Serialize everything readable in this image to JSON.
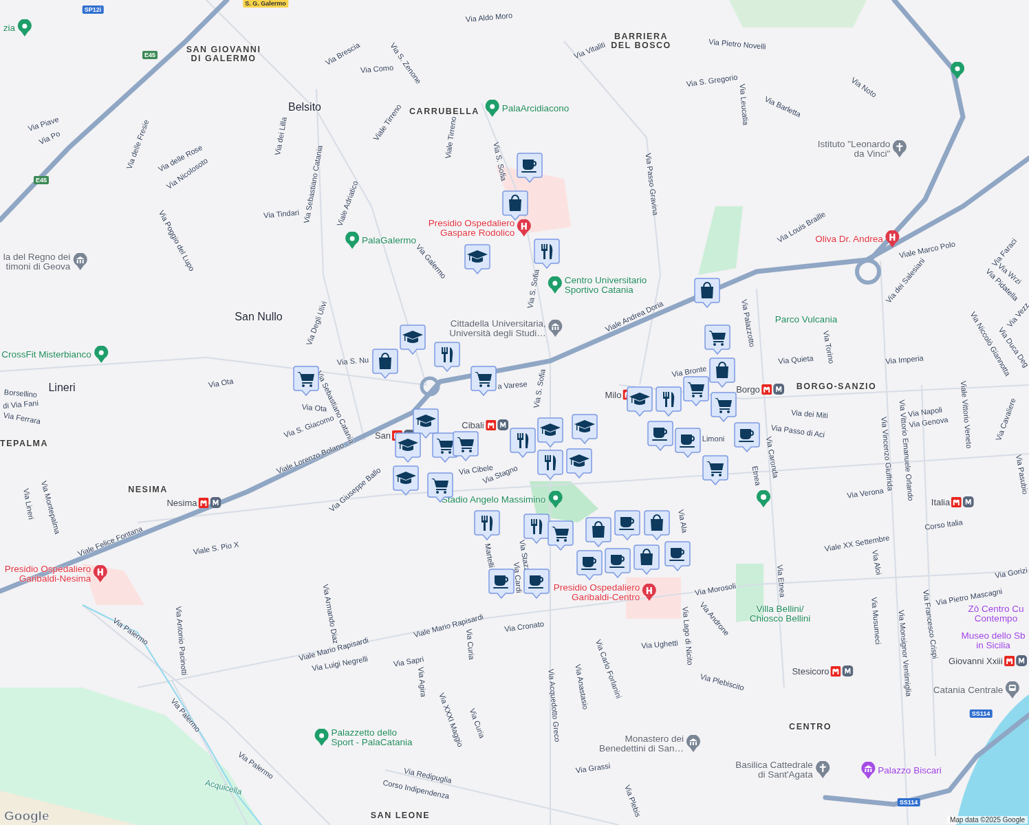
{
  "map": {
    "streets": [
      {
        "text": "Via Aldo Moro"
      },
      {
        "text": "Via Brescia"
      },
      {
        "text": "Via Como"
      },
      {
        "text": "Via S. Zenone"
      },
      {
        "text": "Via Vitaliti"
      },
      {
        "text": "Via Pietro Novelli"
      },
      {
        "text": "Via S. Gregorio"
      },
      {
        "text": "Via Leucatia"
      },
      {
        "text": "Via Barletta"
      },
      {
        "text": "Via Noto"
      },
      {
        "text": "Via Piave"
      },
      {
        "text": "Via Po"
      },
      {
        "text": "Via delle Fresie"
      },
      {
        "text": "Via delle Rose"
      },
      {
        "text": "Via Nicolosoto"
      },
      {
        "text": "Via dei Lilla"
      },
      {
        "text": "Via Sebastiano Catania"
      },
      {
        "text": "Viale Tirreno"
      },
      {
        "text": "Viale Tirreno"
      },
      {
        "text": "Viale Adriatico"
      },
      {
        "text": "Via Tindari"
      },
      {
        "text": "Via Poggio del Lupo"
      },
      {
        "text": "Via S. Sofia"
      },
      {
        "text": "Via Galermo"
      },
      {
        "text": "Via Passo Gravina"
      },
      {
        "text": "Via S. Sofia"
      },
      {
        "text": "Via Louis Braille"
      },
      {
        "text": "Viale Andrea Doria"
      },
      {
        "text": "Viale Marco Polo"
      },
      {
        "text": "Via Faraci"
      },
      {
        "text": "Via Wrzi"
      },
      {
        "text": "Via Pidatella"
      },
      {
        "text": "Via dei Salesiani"
      },
      {
        "text": "Via Palazzotto"
      },
      {
        "text": "Via Torino"
      },
      {
        "text": "Via Quieta"
      },
      {
        "text": "Via Imperia"
      },
      {
        "text": "Via Niccolò Giannotta"
      },
      {
        "text": "Via Duca Deg"
      },
      {
        "text": "Via Vezz"
      },
      {
        "text": "Via Bronte"
      },
      {
        "text": "Via Degli Ulivi"
      },
      {
        "text": "Via S. Nu"
      },
      {
        "text": "Via Ota"
      },
      {
        "text": "Via Ota"
      },
      {
        "text": "Via S. Giacomo"
      },
      {
        "text": "Via Sebastiano Catania"
      },
      {
        "text": "Borsellino"
      },
      {
        "text": "di Via Fani"
      },
      {
        "text": "Via Ferrara"
      },
      {
        "text": "Via S. Sofia"
      },
      {
        "text": "a Varese"
      },
      {
        "text": "Via dei Miti"
      },
      {
        "text": "Via Passo di Aci"
      },
      {
        "text": "Via Napoli"
      },
      {
        "text": "Via Genova"
      },
      {
        "text": "Via Vittorio Emanuele Orlando"
      },
      {
        "text": "Via Vincenzo Giuffrida"
      },
      {
        "text": "Viale Vittorio Veneto"
      },
      {
        "text": "Via Cavaliere"
      },
      {
        "text": "Via Caronda"
      },
      {
        "text": "Etnea"
      },
      {
        "text": "Viale Lorenzo Bolano"
      },
      {
        "text": "Via Cibele"
      },
      {
        "text": "Via Stagno"
      },
      {
        "text": "Via Giuseppe Ballo"
      },
      {
        "text": "Via Verona"
      },
      {
        "text": "Corso Italia"
      },
      {
        "text": "Viale XX Settembre"
      },
      {
        "text": "Via Pasubio"
      },
      {
        "text": "Via Aloi"
      },
      {
        "text": "Via Gorizi"
      },
      {
        "text": "Via Pietro Mascagni"
      },
      {
        "text": "Via Musumeci"
      },
      {
        "text": "Via Monsignor Ventimiglia"
      },
      {
        "text": "Via Francesco Crispi"
      },
      {
        "text": "Via Etnea"
      },
      {
        "text": "Via Morosoli"
      },
      {
        "text": "Via Androne"
      },
      {
        "text": "Via Lago di Nicito"
      },
      {
        "text": "Via Ughetti"
      },
      {
        "text": "Via Plebiscito"
      },
      {
        "text": "Via Carlo Forlanini"
      },
      {
        "text": "Via Anastasio"
      },
      {
        "text": "Via Acquedotto Greco"
      },
      {
        "text": "Via Grassi"
      },
      {
        "text": "Via Plebis"
      },
      {
        "text": "Via Cronato"
      },
      {
        "text": "Viale Mario Rapisardi"
      },
      {
        "text": "Viale Mario Rapisardi"
      },
      {
        "text": "Via Luigi Negrelli"
      },
      {
        "text": "Via Sapri"
      },
      {
        "text": "Via Curia"
      },
      {
        "text": "Via Curia"
      },
      {
        "text": "Via Agira"
      },
      {
        "text": "Via XXXI Maggio"
      },
      {
        "text": "Via Redipuglia"
      },
      {
        "text": "Corso Indipendenza"
      },
      {
        "text": "Via Armando Diaz"
      },
      {
        "text": "Via Antonio Pacinotti"
      },
      {
        "text": "Via Palermo"
      },
      {
        "text": "Via Palermo"
      },
      {
        "text": "Via Palermo"
      },
      {
        "text": "Viale Felice Fontana"
      },
      {
        "text": "Viale S. Pio X"
      },
      {
        "text": "Via Lineri"
      },
      {
        "text": "Via Montepalma"
      },
      {
        "text": "Martelli"
      },
      {
        "text": "Via Stazz"
      },
      {
        "text": "Via Cardi"
      },
      {
        "text": "Via Ala"
      },
      {
        "text": "Limoni"
      }
    ],
    "districts": [
      {
        "text": "SAN GIOVANNI"
      },
      {
        "text": "DI GALERMO"
      },
      {
        "text": "BARRIERA"
      },
      {
        "text": "DEL BOSCO"
      },
      {
        "text": "CARRUBELLA"
      },
      {
        "text": "NESIMA"
      },
      {
        "text": "TEPALMA"
      },
      {
        "text": "BORGO-SANZIO"
      },
      {
        "text": "CENTRO"
      },
      {
        "text": "SAN LEONE"
      }
    ],
    "towns": [
      {
        "text": "Belsito"
      },
      {
        "text": "San Nullo"
      },
      {
        "text": "Lineri"
      }
    ],
    "pois": [
      {
        "kind": "park",
        "lines": [
          "zia"
        ]
      },
      {
        "kind": "park",
        "lines": [
          "PalaArcidiacono"
        ]
      },
      {
        "kind": "park",
        "lines": [
          "PalaGalermo"
        ]
      },
      {
        "kind": "park",
        "lines": [
          "Centro Universitario",
          "Sportivo Catania"
        ]
      },
      {
        "kind": "park",
        "lines": [
          "CrossFit Misterbianco"
        ]
      },
      {
        "kind": "park",
        "lines": [
          "Palazzetto dello",
          "Sport - PalaCatania"
        ]
      },
      {
        "kind": "stadium",
        "lines": [
          "Stadio Angelo Massimino"
        ]
      },
      {
        "kind": "garden",
        "lines": [
          "Parco Vulcania"
        ]
      },
      {
        "kind": "garden",
        "lines": [
          "Villa Bellini/",
          "Chiosco Bellini"
        ]
      },
      {
        "kind": "hospital",
        "lines": [
          "Presidio Ospedaliero",
          "Gaspare Rodolico"
        ]
      },
      {
        "kind": "clinic",
        "lines": [
          "Oliva Dr. Andrea"
        ]
      },
      {
        "kind": "hospital",
        "lines": [
          "Presidio Ospedaliero",
          "Garibaldi-Nesima"
        ]
      },
      {
        "kind": "hospital",
        "lines": [
          "Presidio Ospedaliero",
          "Garibaldi-Centro"
        ]
      },
      {
        "kind": "church",
        "lines": [
          "Istituto \"Leonardo",
          "da Vinci\""
        ]
      },
      {
        "kind": "school",
        "lines": [
          "Cittadella Universitaria,",
          "Università degli Studi…"
        ]
      },
      {
        "kind": "hall",
        "lines": [
          "la del Regno dei",
          "timoni di Geova"
        ]
      },
      {
        "kind": "hall",
        "lines": [
          "Monastero dei",
          "Benedettini di San…"
        ]
      },
      {
        "kind": "church",
        "lines": [
          "Basilica Cattedrale",
          "di Sant'Agata"
        ]
      },
      {
        "kind": "train",
        "lines": [
          "Catania Centrale"
        ]
      },
      {
        "kind": "museum",
        "lines": [
          "Palazzo Biscari"
        ]
      },
      {
        "kind": "museum_text",
        "lines": [
          "Zō Centro Cu",
          "Contempo"
        ]
      },
      {
        "kind": "museum_text",
        "lines": [
          "Museo dello Sb",
          "in Sicilia"
        ]
      }
    ],
    "metro_stations": [
      {
        "name": "Cibali",
        "underground": true
      },
      {
        "name": "Milo",
        "underground": false
      },
      {
        "name": "Borgo",
        "underground": true
      },
      {
        "name": "Nesima",
        "underground": true
      },
      {
        "name": "Italia",
        "underground": true
      },
      {
        "name": "Stesicoro",
        "underground": true
      },
      {
        "name": "Giovanni Xxiii",
        "underground": true
      },
      {
        "name": "San",
        "underground": true
      }
    ],
    "shields": [
      {
        "kind": "provincial",
        "text": "SP12i"
      },
      {
        "kind": "european",
        "text": "E45"
      },
      {
        "kind": "european",
        "text": "E45"
      },
      {
        "kind": "state",
        "text": "SS114"
      },
      {
        "kind": "state",
        "text": "SS114"
      },
      {
        "kind": "locality",
        "text": "S. G. Galermo"
      }
    ],
    "water_labels": [
      {
        "text": "Acquicella"
      }
    ],
    "markers": [
      {
        "kind": "cafe"
      },
      {
        "kind": "shop"
      },
      {
        "kind": "restaurant"
      },
      {
        "kind": "school"
      },
      {
        "kind": "restaurant"
      },
      {
        "kind": "school"
      },
      {
        "kind": "shop"
      },
      {
        "kind": "grocery"
      },
      {
        "kind": "grocery"
      },
      {
        "kind": "school"
      },
      {
        "kind": "school"
      },
      {
        "kind": "grocery"
      },
      {
        "kind": "grocery"
      },
      {
        "kind": "grocery"
      },
      {
        "kind": "restaurant"
      },
      {
        "kind": "school"
      },
      {
        "kind": "restaurant"
      },
      {
        "kind": "school"
      },
      {
        "kind": "school"
      },
      {
        "kind": "school"
      },
      {
        "kind": "restaurant"
      },
      {
        "kind": "restaurant"
      },
      {
        "kind": "grocery"
      },
      {
        "kind": "cafe"
      },
      {
        "kind": "shop"
      },
      {
        "kind": "cafe"
      },
      {
        "kind": "shop"
      },
      {
        "kind": "shop"
      },
      {
        "kind": "cafe"
      },
      {
        "kind": "cafe"
      },
      {
        "kind": "cafe"
      },
      {
        "kind": "cafe"
      },
      {
        "kind": "school"
      },
      {
        "kind": "restaurant"
      },
      {
        "kind": "grocery"
      },
      {
        "kind": "grocery"
      },
      {
        "kind": "cafe"
      },
      {
        "kind": "cafe"
      },
      {
        "kind": "grocery"
      },
      {
        "kind": "cafe"
      },
      {
        "kind": "shop"
      },
      {
        "kind": "grocery"
      },
      {
        "kind": "shop"
      }
    ]
  },
  "attribution": {
    "logo": "Google",
    "text": "Map data ©2025 Google"
  }
}
